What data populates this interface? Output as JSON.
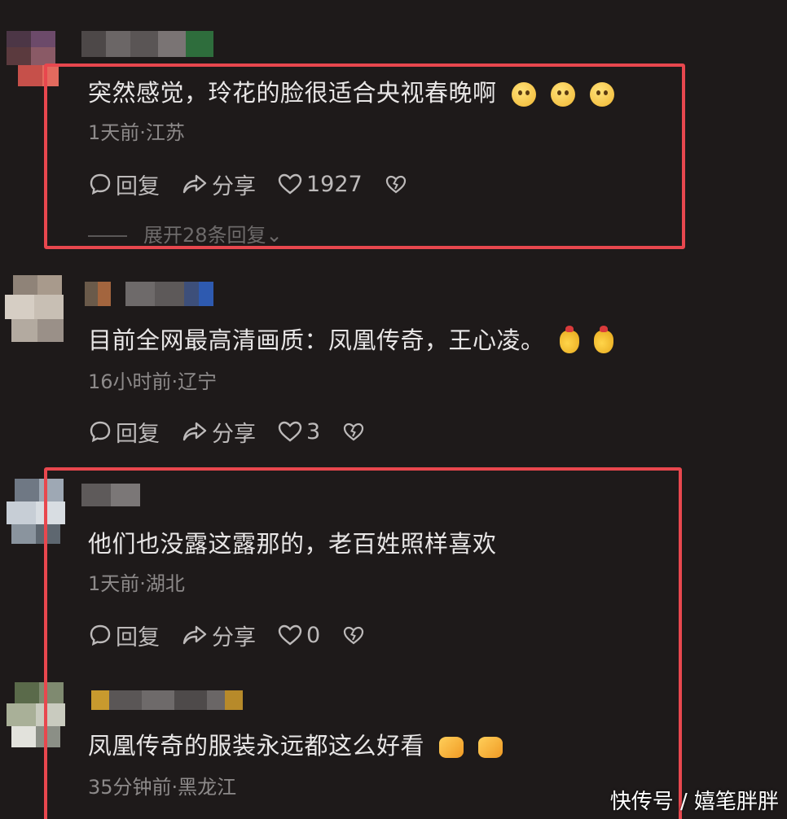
{
  "comments": [
    {
      "text": "突然感觉，玲花的脸很适合央视春晚啊",
      "emojis": [
        "thinking-face",
        "thinking-face",
        "thinking-face"
      ],
      "meta": "1天前·江苏",
      "reply_label": "回复",
      "share_label": "分享",
      "likes": "1927",
      "expand_label": "展开28条回复",
      "highlighted": true
    },
    {
      "text": "目前全网最高清画质：凤凰传奇，王心凌。",
      "emojis": [
        "money-bag",
        "money-bag"
      ],
      "meta": "16小时前·辽宁",
      "reply_label": "回复",
      "share_label": "分享",
      "likes": "3",
      "highlighted": false
    },
    {
      "text": "他们也没露这露那的，老百姓照样喜欢",
      "emojis": [],
      "meta": "1天前·湖北",
      "reply_label": "回复",
      "share_label": "分享",
      "likes": "0",
      "highlighted": true
    },
    {
      "text": "凤凰传奇的服装永远都这么好看",
      "emojis": [
        "pointing-hand",
        "pointing-hand"
      ],
      "meta": "35分钟前·黑龙江",
      "highlighted": true
    }
  ],
  "watermark": "快传号 / 嬉笔胖胖",
  "colors": {
    "background": "#1e1a1a",
    "highlight": "#e8474e",
    "text": "#e8e6e6",
    "meta": "#8d8a8a"
  }
}
